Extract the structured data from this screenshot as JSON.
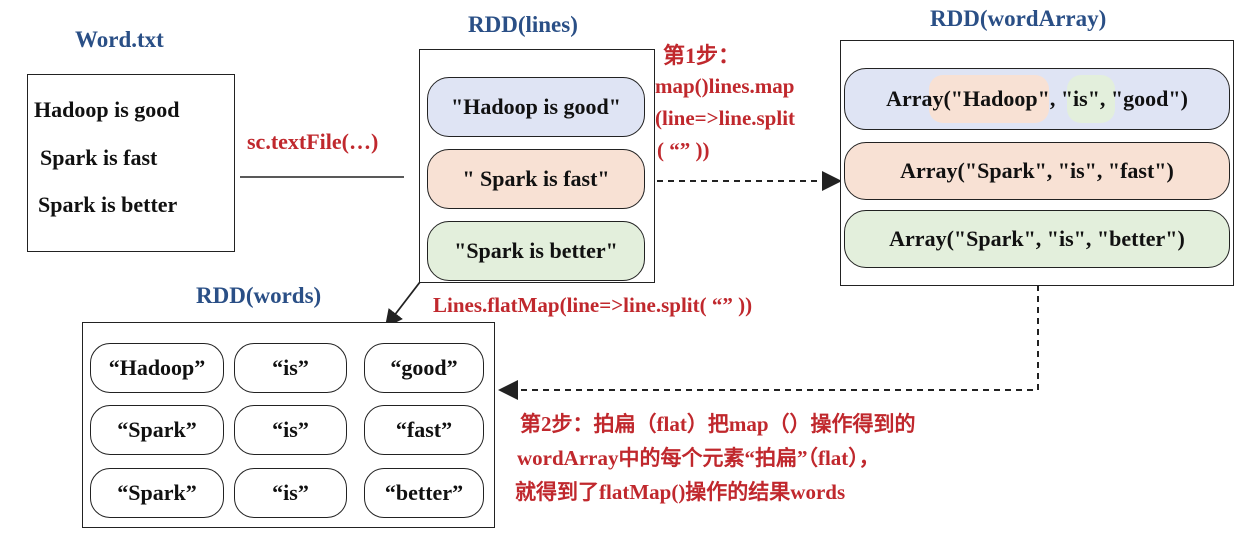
{
  "word_file": {
    "title": "Word.txt",
    "lines": [
      "Hadoop is good",
      "Spark is fast",
      "Spark is better"
    ]
  },
  "rdd_lines": {
    "title": "RDD(lines)",
    "items": [
      "\"Hadoop is good\"",
      "\" Spark is fast\"",
      "\"Spark is better\""
    ],
    "colors": [
      "#dfe4f4",
      "#f8e1d4",
      "#e3efdc"
    ]
  },
  "rdd_word_array": {
    "title": "RDD(wordArray)",
    "items": [
      "Array(\"Hadoop\", \"is\", \"good\")",
      "Array(\"Spark\", \"is\", \"fast\")",
      "Array(\"Spark\", \"is\", \"better\")"
    ],
    "colors": [
      "#dfe4f4",
      "#f8e1d4",
      "#e3efdc"
    ]
  },
  "rdd_words": {
    "title": "RDD(words)",
    "rows": [
      [
        "“Hadoop”",
        "“is”",
        "“good”"
      ],
      [
        "“Spark”",
        "“is”",
        "“fast”"
      ],
      [
        "“Spark”",
        "“is”",
        "“better”"
      ]
    ]
  },
  "labels": {
    "textfile": "sc.textFile(…)",
    "step1_title": "第1步：",
    "step1_lines": [
      "map()lines.map",
      "(line=>line.split",
      "( “” ))"
    ],
    "flatmap": "Lines.flatMap(line=>line.split( “” ))",
    "step2_lines": [
      "第2步：拍扁（flat）把map（）操作得到的",
      "wordArray中的每个元素“拍扁”（flat），",
      "就得到了flatMap()操作的结果words"
    ]
  },
  "colors": {
    "title": "#2a4f86",
    "accent_red": "#c0282d"
  }
}
